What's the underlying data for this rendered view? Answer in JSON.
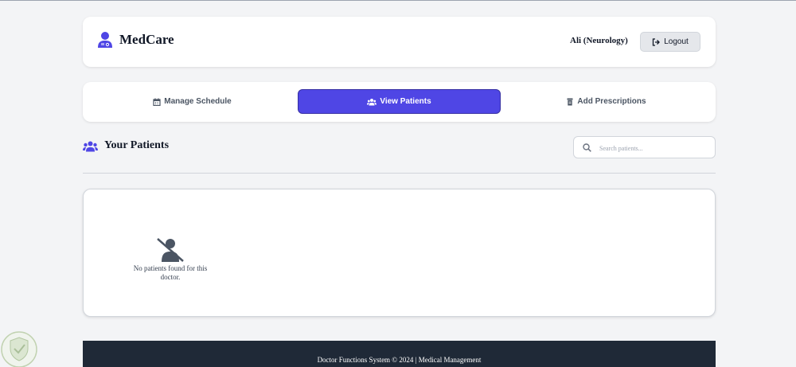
{
  "header": {
    "brand_name": "MedCare",
    "brand_icon": "user-doctor-icon",
    "user_display": "Ali (Neurology)",
    "logout_label": "Logout",
    "logout_icon": "sign-out-icon"
  },
  "tabs": [
    {
      "label": "Manage Schedule",
      "icon": "calendar-icon",
      "active": false
    },
    {
      "label": "View Patients",
      "icon": "users-icon",
      "active": true
    },
    {
      "label": "Add Prescriptions",
      "icon": "prescription-bottle-icon",
      "active": false
    }
  ],
  "patients": {
    "title": "Your Patients",
    "title_icon": "users-icon",
    "search_placeholder": "Search patients...",
    "search_value": "",
    "empty_message": "No patients found for this doctor.",
    "empty_icon": "user-slash-icon"
  },
  "footer": {
    "text": "Doctor Functions System © 2024 | Medical Management"
  },
  "colors": {
    "accent": "#4f46e5",
    "footer_bg": "#1f2937",
    "page_bg": "#f3f4f6"
  }
}
